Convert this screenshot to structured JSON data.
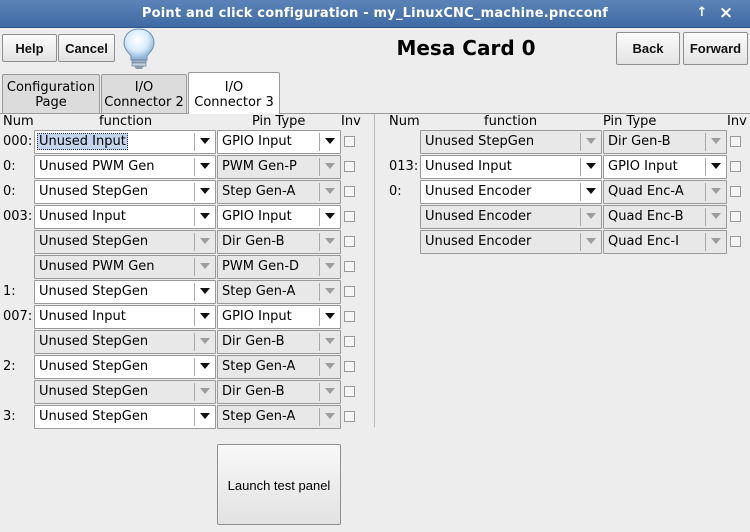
{
  "window": {
    "title": "Point and click configuration - my_LinuxCNC_machine.pncconf",
    "up_glyph": "↑",
    "close_glyph": "×"
  },
  "toolbar": {
    "help_label": "Help",
    "cancel_label": "Cancel",
    "card_title": "Mesa Card 0",
    "back_label": "Back",
    "forward_label": "Forward",
    "hint_icon": "lightbulb-icon"
  },
  "tabs": [
    {
      "line1": "Configuration",
      "line2": "Page"
    },
    {
      "line1": "I/O",
      "line2": "Connector 2"
    },
    {
      "line1": "I/O",
      "line2": "Connector 3"
    }
  ],
  "headers": {
    "num": "Num",
    "function": "function",
    "pin_type": "Pin Type",
    "inv": "Inv"
  },
  "left_rows": [
    {
      "num": "000:",
      "function": "Unused Input",
      "pin_type": "GPIO Input",
      "fn_enabled": true,
      "pt_enabled": true,
      "selected": true
    },
    {
      "num": "0:",
      "function": "Unused PWM Gen",
      "pin_type": "PWM Gen-P",
      "fn_enabled": true,
      "pt_enabled": false
    },
    {
      "num": "0:",
      "function": "Unused StepGen",
      "pin_type": "Step Gen-A",
      "fn_enabled": true,
      "pt_enabled": false
    },
    {
      "num": "003:",
      "function": "Unused Input",
      "pin_type": "GPIO Input",
      "fn_enabled": true,
      "pt_enabled": true
    },
    {
      "num": "",
      "function": "Unused StepGen",
      "pin_type": "Dir Gen-B",
      "fn_enabled": false,
      "pt_enabled": false
    },
    {
      "num": "",
      "function": "Unused PWM Gen",
      "pin_type": "PWM Gen-D",
      "fn_enabled": false,
      "pt_enabled": false
    },
    {
      "num": "1:",
      "function": "Unused StepGen",
      "pin_type": "Step Gen-A",
      "fn_enabled": true,
      "pt_enabled": false
    },
    {
      "num": "007:",
      "function": "Unused Input",
      "pin_type": "GPIO Input",
      "fn_enabled": true,
      "pt_enabled": true
    },
    {
      "num": "",
      "function": "Unused StepGen",
      "pin_type": "Dir Gen-B",
      "fn_enabled": false,
      "pt_enabled": false
    },
    {
      "num": "2:",
      "function": "Unused StepGen",
      "pin_type": "Step Gen-A",
      "fn_enabled": true,
      "pt_enabled": false
    },
    {
      "num": "",
      "function": "Unused StepGen",
      "pin_type": "Dir Gen-B",
      "fn_enabled": false,
      "pt_enabled": false
    },
    {
      "num": "3:",
      "function": "Unused StepGen",
      "pin_type": "Step Gen-A",
      "fn_enabled": true,
      "pt_enabled": false
    }
  ],
  "right_rows": [
    {
      "num": "",
      "function": "Unused StepGen",
      "pin_type": "Dir Gen-B",
      "fn_enabled": false,
      "pt_enabled": false
    },
    {
      "num": "013:",
      "function": "Unused Input",
      "pin_type": "GPIO Input",
      "fn_enabled": true,
      "pt_enabled": true
    },
    {
      "num": "0:",
      "function": "Unused Encoder",
      "pin_type": "Quad Enc-A",
      "fn_enabled": true,
      "pt_enabled": false
    },
    {
      "num": "",
      "function": "Unused Encoder",
      "pin_type": "Quad Enc-B",
      "fn_enabled": false,
      "pt_enabled": false
    },
    {
      "num": "",
      "function": "Unused Encoder",
      "pin_type": "Quad Enc-I",
      "fn_enabled": false,
      "pt_enabled": false
    }
  ],
  "launch_label": "Launch test panel"
}
